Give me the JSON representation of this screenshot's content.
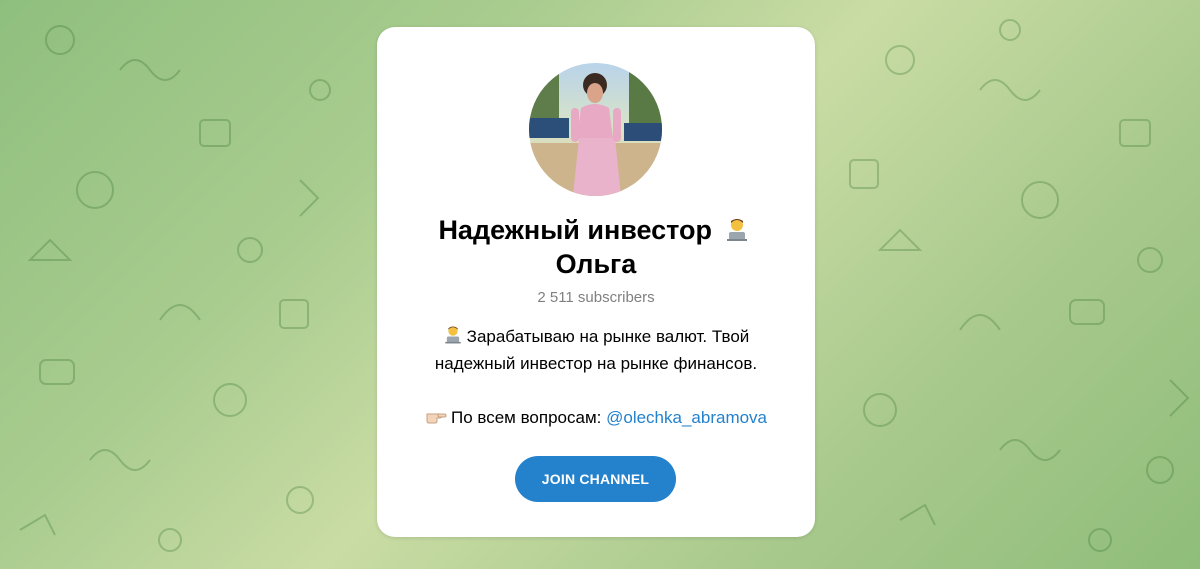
{
  "channel": {
    "title_line1": "Надежный инвестор",
    "title_line2": "Ольга",
    "subscribers": "2 511 subscribers",
    "description_line1": "Зарабатываю на рынке валют. Твой",
    "description_line2": "надежный инвестор на рынке финансов.",
    "contact_prefix": "По всем вопросам:",
    "contact_handle": "@olechka_abramova"
  },
  "actions": {
    "join_label": "JOIN CHANNEL"
  },
  "icons": {
    "title_emoji": "woman-technologist-emoji",
    "description_emoji": "woman-technologist-emoji",
    "contact_emoji": "pointing-right-emoji"
  },
  "colors": {
    "accent": "#2481cc",
    "subtitle": "#808080",
    "card": "#ffffff"
  }
}
